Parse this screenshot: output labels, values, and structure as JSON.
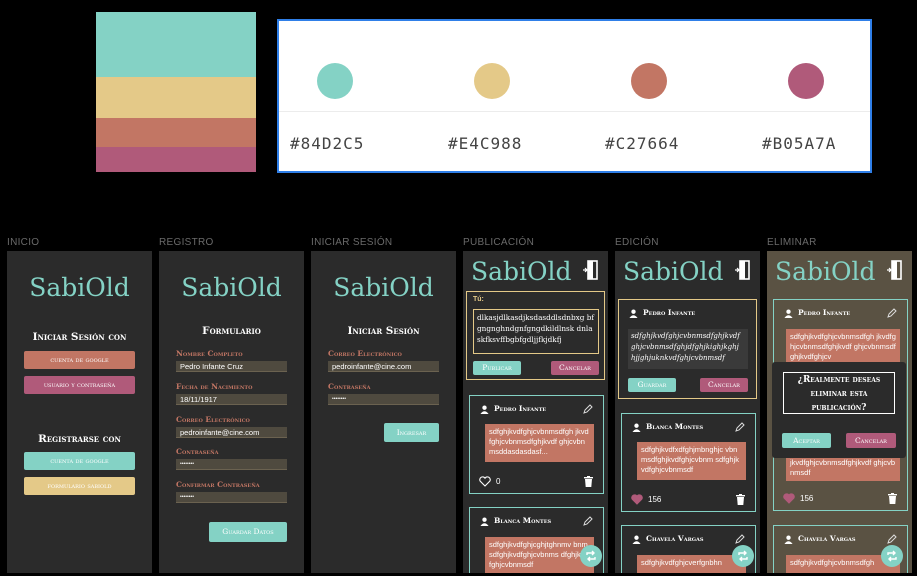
{
  "palette": {
    "colors": [
      {
        "hex_label": "#84D2C5",
        "value": "#84D2C5"
      },
      {
        "hex_label": "#E4C988",
        "value": "#E4C988"
      },
      {
        "hex_label": "#C27664",
        "value": "#C27664"
      },
      {
        "hex_label": "#B05A7A",
        "value": "#B05A7A"
      }
    ]
  },
  "screens": {
    "inicio": {
      "label": "INICIO",
      "logo": "SabiOld",
      "login_title": "Iniciar Sesión con",
      "google_btn": "cuenta de google",
      "user_btn": "usuario y contraseña",
      "register_title": "Registrarse con",
      "register_google_btn": "cuenta de google",
      "register_form_btn": "formulario sabiold"
    },
    "registro": {
      "label": "REGISTRO",
      "logo": "SabiOld",
      "title": "Formulario",
      "name_label": "Nombre Completo",
      "name_value": "Pedro Infante Cruz",
      "birth_label": "Fecha de Nacimiento",
      "birth_value": "18/11/1917",
      "email_label": "Correo Electrónico",
      "email_value": "pedroinfante@cine.com",
      "password_label": "Contraseña",
      "password_value": "••••••••",
      "confirm_label": "Confirmar Contraseña",
      "confirm_value": "••••••••",
      "save_btn": "Guardar Datos"
    },
    "login": {
      "label": "INICIAR SESIÓN",
      "logo": "SabiOld",
      "title": "Iniciar Sesión",
      "email_label": "Correo Electrónico",
      "email_value": "pedroinfante@cine.com",
      "password_label": "Contraseña",
      "password_value": "••••••••",
      "submit_btn": "Ingresar"
    },
    "publicacion": {
      "label": "PUBLICACIÓN",
      "logo": "SabiOld",
      "compose_label": "Tú:",
      "compose_text": "dlkasjdlkasdjksdasddlsdnbxg bfgngnghndgnfgngdkildlnsk dnlaskfksvffbgbfgdljjfkjdkfj",
      "publish_btn": "Publicar",
      "cancel_btn": "Cancelar",
      "post1_user": "Pedro Infante",
      "post1_text": "sdfghjkvdfghjcvbnmsdfgh jkvdfghjcvbnmsdfghjkvdf ghjcvbnmsddasdasdasf...",
      "post1_likes": "0",
      "post2_user": "Blanca Montes",
      "post2_text": "sdfghjkvdfghjcghjtghnmv bnmsdfghjkvdfghjcvbnms dfghjkvdfghjcvbnmsdf"
    },
    "edicion": {
      "label": "EDICIÓN",
      "logo": "SabiOld",
      "edit_user": "Pedro Infante",
      "edit_text": "sdfghjkvdfghjcvbnmsdfghjkvdf ghjcvbnmsdfghjdfghjkighjkghj hjjghjuknkvdfghjcvbnmsdf",
      "save_btn": "Guardar",
      "cancel_btn": "Cancelar",
      "post2_user": "Blanca Montes",
      "post2_text": "sdfghjkvdfxdfghjmbnghjc vbnmsdfghjkvdfghjcvbnm sdfghjkvdfghjcvbnmsdf",
      "post2_likes": "156",
      "post3_user": "Chavela Vargas",
      "post3_text": "sdfghjkvdfghjcverfgnbhn"
    },
    "eliminar": {
      "label": "ELIMINAR",
      "logo": "SabiOld",
      "post1_user": "Pedro Infante",
      "post1_text": "sdfghjkvdfghjcvbnmsdfgh jkvdfghjcvbnmsdfghjkvdf ghjcvbnmsdfghjkvdfghjcv",
      "post1_text_tail": "jkvdfghjcvbnmsdfghjkvdf ghjcvbnmsdf",
      "post1_likes": "156",
      "dialog_text": "¿Realmente deseas eliminar esta publicación?",
      "accept_btn": "Aceptar",
      "cancel_btn": "Cancelar",
      "post2_user": "Chavela Vargas",
      "post2_text": "sdfghjkvdfghjcvbnmsdfgh"
    }
  }
}
